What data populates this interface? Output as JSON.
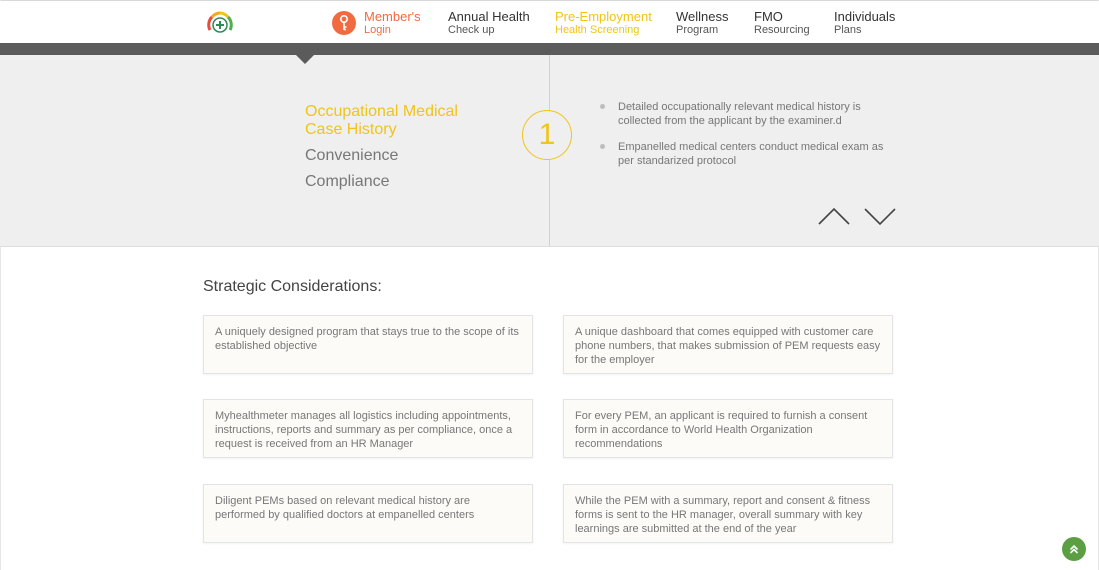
{
  "nav": {
    "items": [
      {
        "title": "Member's",
        "sub": "Login"
      },
      {
        "title": "Annual Health",
        "sub": "Check up"
      },
      {
        "title": "Pre-Employment",
        "sub": "Health Screening"
      },
      {
        "title": "Wellness",
        "sub": "Program"
      },
      {
        "title": "FMO",
        "sub": "Resourcing"
      },
      {
        "title": "Individuals",
        "sub": "Plans"
      }
    ]
  },
  "colors": {
    "accent_orange": "#f06b40",
    "accent_yellow": "#f0c419",
    "bar_dark": "#5b5b5b",
    "panel_bg": "#efefef",
    "fab_green": "#5b9e43"
  },
  "icons": {
    "logo": "health-meter-logo",
    "login": "key-icon",
    "up": "chevron-up-icon",
    "down": "chevron-down-icon",
    "fab": "double-chevron-up-icon"
  },
  "carousel": {
    "number": "1",
    "topics": [
      {
        "line1": "Occupational Medical",
        "line2": "Case History"
      },
      {
        "line1": "Convenience"
      },
      {
        "line1": "Compliance"
      }
    ],
    "bullets": [
      "Detailed occupationally relevant medical history is collected from the applicant by the examiner.d",
      "Empanelled medical centers conduct medical exam as per standarized protocol"
    ]
  },
  "strategic": {
    "title": "Strategic Considerations:",
    "cards": [
      "A uniquely designed program that stays true to the scope of its established objective",
      "A unique dashboard that comes equipped with customer care phone numbers, that makes submission of PEM requests easy for the employer",
      "Myhealthmeter manages all logistics including appointments, instructions, reports and summary as per compliance, once a request is received from an HR Manager",
      "For every PEM, an applicant is required to furnish a consent form in accordance to World Health Organization recommendations",
      "Diligent PEMs based on relevant medical history are performed by qualified doctors at empanelled centers",
      "While the PEM with a summary, report and consent & fitness forms is sent to the HR manager, overall summary with key learnings are submitted at the end of the year"
    ]
  }
}
